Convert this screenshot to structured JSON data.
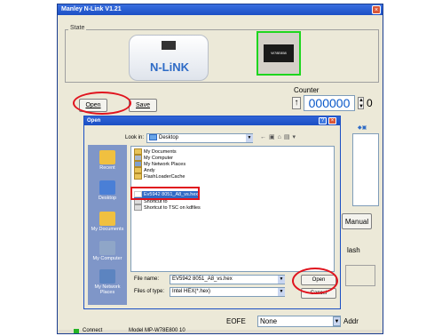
{
  "window": {
    "title": "Manley N-Link V1.21",
    "close_glyph": "×"
  },
  "state_group": {
    "label": "State"
  },
  "device": {
    "brand": "N-LiNK",
    "chip_label": "W78E858"
  },
  "toolbar": {
    "open_label": "Open",
    "save_label": "Save"
  },
  "counter": {
    "label": "Counter",
    "value": "000000",
    "digit": "0"
  },
  "right_buttons": {
    "manual_label": "Manual",
    "flash_label": "lash"
  },
  "bottom": {
    "eofe_label": "EOFE",
    "eofe_value": "None",
    "addr_label": "Addr"
  },
  "status": {
    "connect_label": "Connect",
    "model_label": "Model MP-W78E800 10"
  },
  "dialog": {
    "title": "Open",
    "look_in_label": "Look in:",
    "look_in_value": "Desktop",
    "places": [
      {
        "label": "Recent",
        "icon": "recent-icon"
      },
      {
        "label": "Desktop",
        "icon": "desktop-icon"
      },
      {
        "label": "My Documents",
        "icon": "my-documents-icon"
      },
      {
        "label": "My Computer",
        "icon": "my-computer-icon"
      },
      {
        "label": "My Network Places",
        "icon": "network-places-icon"
      }
    ],
    "files": [
      "My Documents",
      "My Computer",
      "My Network Places",
      "Andy",
      "FlashLoaderCache",
      "Ev5942 8051_A8_vs.hex",
      "Shortcut to",
      "Shortcut to TSC on kdfiles"
    ],
    "file_name_label": "File name:",
    "file_name_value": "EV5942 8051_A8_vs.hex",
    "file_type_label": "Files of type:",
    "file_type_value": "Intel HEX(*.hex)",
    "open_button": "Open",
    "cancel_button": "Cancel"
  }
}
